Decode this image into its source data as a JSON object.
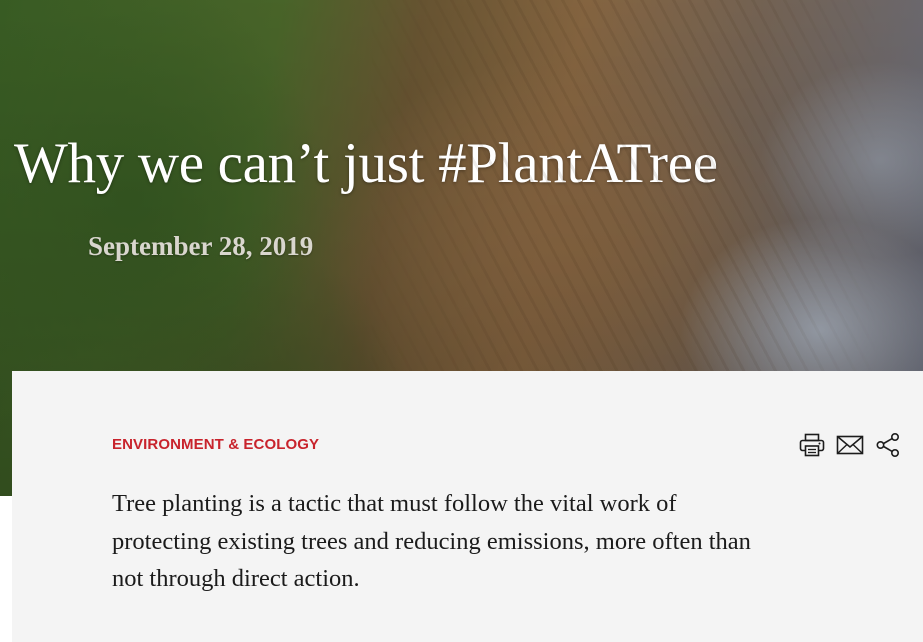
{
  "article": {
    "title": "Why we can’t just #PlantATree",
    "date": "September 28, 2019",
    "category": "ENVIRONMENT & ECOLOGY",
    "summary": "Tree planting is a tactic that must follow the vital work of protecting existing trees and reducing emissions, more often than not through direct action."
  },
  "tools": {
    "icons": [
      "printer-icon",
      "mail-icon",
      "share-icon"
    ]
  },
  "colors": {
    "category": "#c8232c",
    "card_background": "#f4f4f4",
    "title": "#ffffff",
    "date": "#d9d6ce",
    "body_text": "#1b1b1b"
  }
}
